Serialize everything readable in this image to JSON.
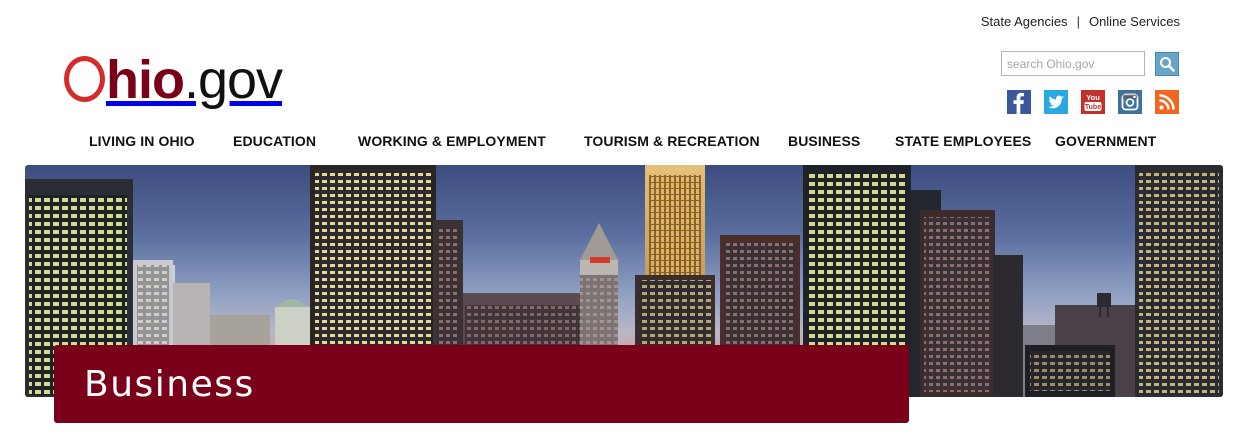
{
  "header": {
    "util_links": [
      "State Agencies",
      "Online Services"
    ],
    "separator": "|",
    "logo": {
      "hio": "hio",
      "gov": ".gov",
      "alt": "Ohio.gov"
    },
    "search": {
      "placeholder": "search Ohio.gov",
      "value": ""
    },
    "social_icons": [
      "facebook-icon",
      "twitter-icon",
      "youtube-icon",
      "instagram-icon",
      "rss-icon"
    ],
    "youtube_text": "You Tube"
  },
  "nav": {
    "items": [
      "LIVING IN OHIO",
      "EDUCATION",
      "WORKING & EMPLOYMENT",
      "TOURISM & RECREATION",
      "BUSINESS",
      "STATE EMPLOYEES",
      "GOVERNMENT"
    ]
  },
  "banner": {
    "title": "Business"
  },
  "colors": {
    "brand_maroon": "#7a0019",
    "logo_red": "#d62b2b",
    "search_button": "#6aa3c8"
  }
}
